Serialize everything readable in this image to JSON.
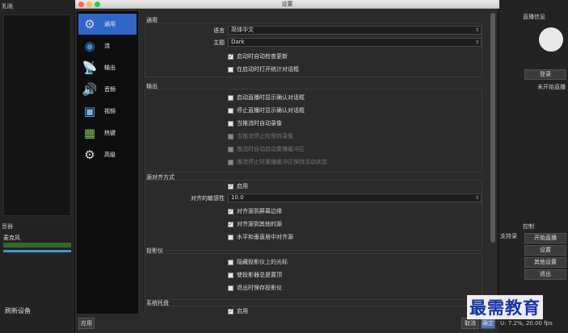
{
  "background": {
    "left_title": "乳晚",
    "mixer_title": "音器",
    "mixer_item": "麦克风",
    "refresh": "刷新设备",
    "right_title": "直播信息",
    "login": "登录",
    "not_live": "未开始直播",
    "controls_title": "控制",
    "side_text": "支持录",
    "start_stream": "开始直播",
    "settings": "设置",
    "other_settings": "其他设置",
    "exit": "退出",
    "status": "U: 7.2%, 20.00 fps"
  },
  "window": {
    "title": "设置",
    "traffic_colors": [
      "#fc605c",
      "#fdbc40",
      "#34c84a"
    ]
  },
  "sidebar": {
    "items": [
      {
        "label": "通用",
        "icon": "gear-wrench-icon",
        "selected": true
      },
      {
        "label": "流",
        "icon": "globe-icon",
        "selected": false
      },
      {
        "label": "输出",
        "icon": "satellite-dish-icon",
        "selected": false
      },
      {
        "label": "音频",
        "icon": "speaker-icon",
        "selected": false
      },
      {
        "label": "视频",
        "icon": "monitor-icon",
        "selected": false
      },
      {
        "label": "热键",
        "icon": "keyboard-icon",
        "selected": false
      },
      {
        "label": "高级",
        "icon": "gears-icon",
        "selected": false
      }
    ]
  },
  "general": {
    "title": "通用",
    "language_label": "语言",
    "language_value": "简体中文",
    "theme_label": "主题",
    "theme_value": "Dark",
    "check_updates": "启动时自动检查更新",
    "open_stats": "在启动时打开统计对话框"
  },
  "output": {
    "title": "输出",
    "confirm_start": "启动直播时显示确认对话框",
    "confirm_stop": "停止直播时显示确认对话框",
    "auto_record": "当推流时自动录像",
    "keep_recording": "当推流停止时保持录像",
    "replay_start": "推流时自动启动重播缓冲区",
    "replay_keep": "推流停止时重播缓冲区保持活动状态"
  },
  "snapping": {
    "title": "源对齐方式",
    "enable": "启用",
    "sensitivity_label": "对齐的敏感性",
    "sensitivity_value": "10.0",
    "snap_edges": "对齐源到屏幕边缘",
    "snap_sources": "对齐源到其他的源",
    "snap_center": "水平和垂直居中对齐源"
  },
  "projector": {
    "title": "投影仪",
    "hide_cursor": "隐藏投影仪上的光标",
    "always_top": "使投影器总是置顶",
    "save_on_exit": "退出时保存投影仪"
  },
  "tray": {
    "title": "系统托盘",
    "enable": "启用"
  },
  "footer": {
    "apply": "应用",
    "cancel": "取消",
    "ok": "确定"
  },
  "watermark": "最需教育"
}
